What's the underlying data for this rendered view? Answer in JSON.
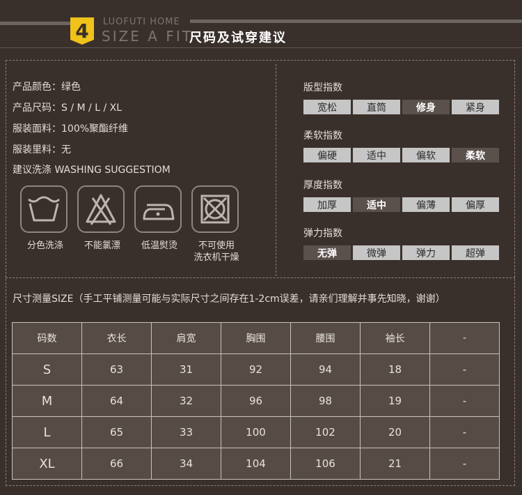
{
  "header": {
    "number": "4",
    "subtitle": "LUOFUTI HOME",
    "title_en": "SIZE  A  FIT",
    "title_cn": "尺码及试穿建议"
  },
  "product_info": [
    "产品颜色：绿色",
    "产品尺码：S / M / L / XL",
    "服装面料：100%聚酯纤维",
    "服装里料：无",
    "建议洗涤 WASHING SUGGESTIOM"
  ],
  "care": [
    {
      "icon": "hand-wash-icon",
      "label_line1": "分色洗涤",
      "label_line2": ""
    },
    {
      "icon": "no-bleach-icon",
      "label_line1": "不能氯漂",
      "label_line2": ""
    },
    {
      "icon": "iron-low-icon",
      "label_line1": "低温熨烫",
      "label_line2": ""
    },
    {
      "icon": "no-tumble-dry-icon",
      "label_line1": "不可使用",
      "label_line2": "洗衣机干燥"
    }
  ],
  "indexes": [
    {
      "title": "版型指数",
      "options": [
        "宽松",
        "直筒",
        "修身",
        "紧身"
      ],
      "selected": 2
    },
    {
      "title": "柔软指数",
      "options": [
        "偏硬",
        "适中",
        "偏软",
        "柔软"
      ],
      "selected": 3
    },
    {
      "title": "厚度指数",
      "options": [
        "加厚",
        "适中",
        "偏薄",
        "偏厚"
      ],
      "selected": 1
    },
    {
      "title": "弹力指数",
      "options": [
        "无弹",
        "微弹",
        "弹力",
        "超弹"
      ],
      "selected": 0
    }
  ],
  "note": "尺寸测量SIZE（手工平铺测量可能与实际尺寸之间存在1-2cm误差，请亲们理解并事先知晓，谢谢）",
  "table": {
    "headers": [
      "码数",
      "衣长",
      "肩宽",
      "胸围",
      "腰围",
      "袖长",
      "-"
    ],
    "rows": [
      [
        "S",
        "63",
        "31",
        "92",
        "94",
        "18",
        "-"
      ],
      [
        "M",
        "64",
        "32",
        "96",
        "98",
        "19",
        "-"
      ],
      [
        "L",
        "65",
        "33",
        "100",
        "102",
        "20",
        "-"
      ],
      [
        "XL",
        "66",
        "34",
        "104",
        "106",
        "21",
        "-"
      ]
    ]
  },
  "colors": {
    "background": "#3a302b",
    "badge": "#f0c21a",
    "index_cell": "#c6c6c6",
    "index_active": "#5a514c",
    "table_cell": "#574c45"
  }
}
